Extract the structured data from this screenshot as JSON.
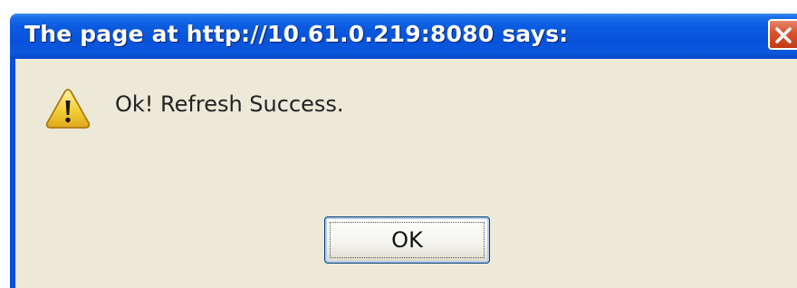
{
  "dialog": {
    "title": "The page at http://10.61.0.219:8080 says:",
    "message": "Ok! Refresh Success.",
    "ok_label": "OK",
    "icon": "warning-icon"
  },
  "colors": {
    "titlebar": "#0852d8",
    "client_background": "#ece9d8",
    "close_button": "#d8532e",
    "warning_yellow": "#f5d33c"
  }
}
